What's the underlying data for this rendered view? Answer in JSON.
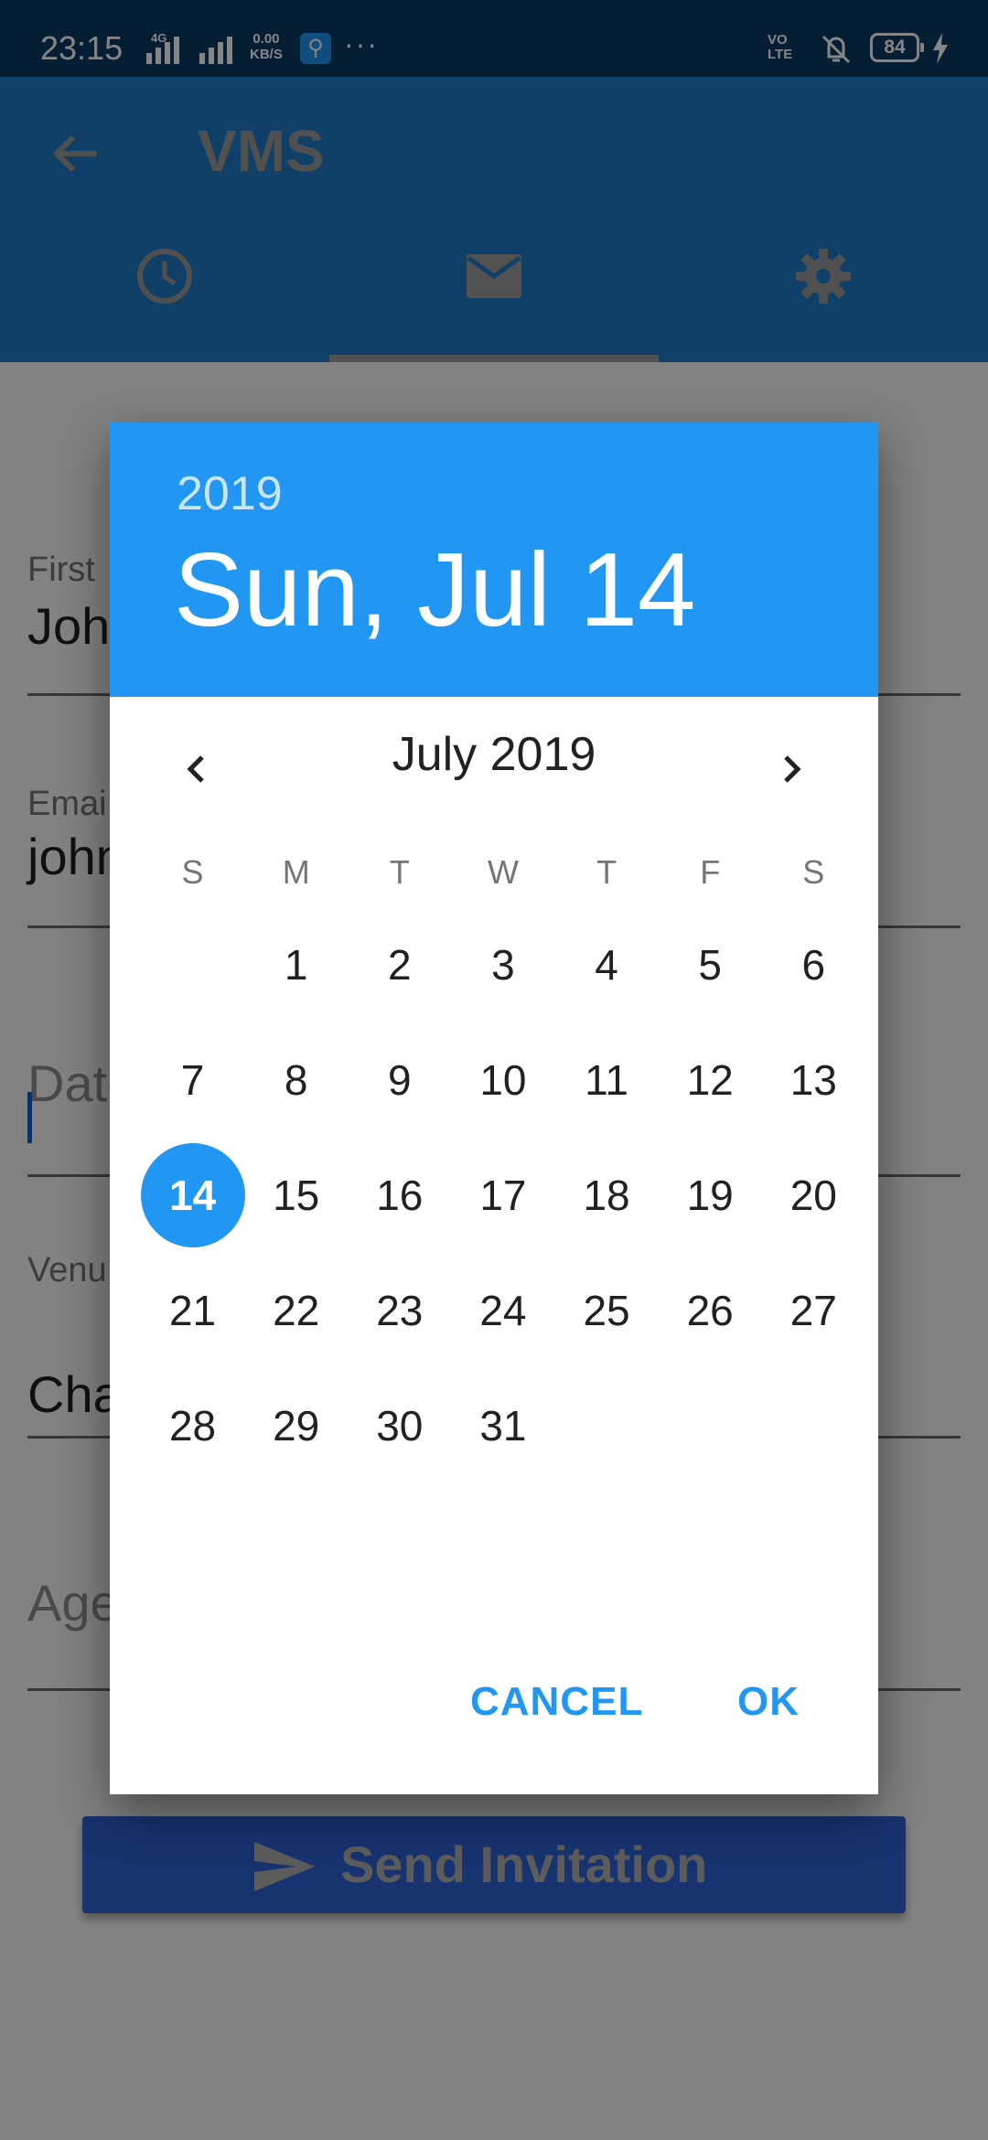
{
  "status_bar": {
    "time": "23:15",
    "network_type": "4G",
    "data_rate_value": "0.00",
    "data_rate_unit": "KB/S",
    "volte": "VO LTE",
    "battery": "84"
  },
  "app_bar": {
    "title": "VMS",
    "tabs": [
      {
        "icon": "clock-icon",
        "selected": false
      },
      {
        "icon": "mail-icon",
        "selected": true
      },
      {
        "icon": "gear-icon",
        "selected": false
      }
    ]
  },
  "form": {
    "first_name_label": "First",
    "first_name_value": "Joh",
    "email_label": "Emai",
    "email_value": "john",
    "date_hint": "Date",
    "venue_label": "Venu",
    "venue_value": "Cha",
    "agenda_hint": "Age",
    "send_button_label": "Send Invitation"
  },
  "date_picker": {
    "header_year": "2019",
    "header_date": "Sun, Jul 14",
    "month_label": "July 2019",
    "weekdays": [
      "S",
      "M",
      "T",
      "W",
      "T",
      "F",
      "S"
    ],
    "leading_blank_days": 1,
    "days": [
      "1",
      "2",
      "3",
      "4",
      "5",
      "6",
      "7",
      "8",
      "9",
      "10",
      "11",
      "12",
      "13",
      "14",
      "15",
      "16",
      "17",
      "18",
      "19",
      "20",
      "21",
      "22",
      "23",
      "24",
      "25",
      "26",
      "27",
      "28",
      "29",
      "30",
      "31"
    ],
    "selected_day": "14",
    "cancel_label": "CANCEL",
    "ok_label": "OK"
  },
  "colors": {
    "primary": "#2196f3",
    "status_bar": "#0d3a63",
    "app_bar": "#1f7bc6",
    "send_button": "#2d63d6"
  }
}
